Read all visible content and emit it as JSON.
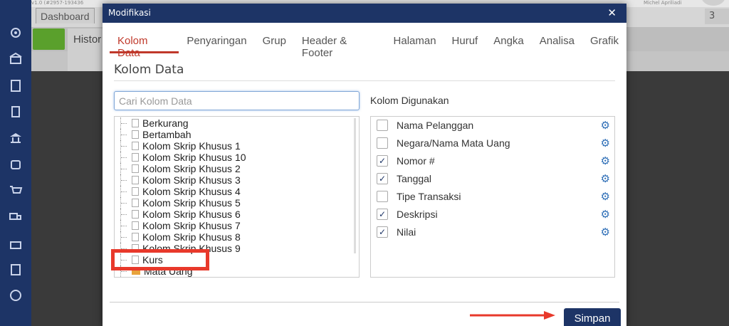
{
  "app": {
    "version": "v1.0 (#2957-193436",
    "user": "Michel Apriliadi",
    "tab_dashboard": "Dashboard",
    "tab_right_value": "3",
    "history_tab": "Histor"
  },
  "sidebar": {
    "icons": [
      "gear-icon",
      "store-icon",
      "building-icon",
      "book-icon",
      "bank-icon",
      "bag-icon",
      "cart-icon",
      "truck-icon",
      "inventory-icon",
      "tax-icon",
      "report-icon"
    ]
  },
  "dialog": {
    "title": "Modifikasi",
    "close": "✕",
    "tabs": [
      "Kolom Data",
      "Penyaringan",
      "Grup",
      "Header & Footer",
      "Halaman",
      "Huruf",
      "Angka",
      "Analisa",
      "Grafik"
    ],
    "active_tab": "Kolom Data",
    "section_title": "Kolom Data",
    "search_placeholder": "Cari Kolom Data",
    "tree_items": [
      {
        "label": "Berkurang",
        "type": "file"
      },
      {
        "label": "Bertambah",
        "type": "file"
      },
      {
        "label": "Kolom Skrip Khusus 1",
        "type": "file"
      },
      {
        "label": "Kolom Skrip Khusus 10",
        "type": "file"
      },
      {
        "label": "Kolom Skrip Khusus 2",
        "type": "file"
      },
      {
        "label": "Kolom Skrip Khusus 3",
        "type": "file"
      },
      {
        "label": "Kolom Skrip Khusus 4",
        "type": "file"
      },
      {
        "label": "Kolom Skrip Khusus 5",
        "type": "file"
      },
      {
        "label": "Kolom Skrip Khusus 6",
        "type": "file"
      },
      {
        "label": "Kolom Skrip Khusus 7",
        "type": "file"
      },
      {
        "label": "Kolom Skrip Khusus 8",
        "type": "file"
      },
      {
        "label": "Kolom Skrip Khusus 9",
        "type": "file"
      },
      {
        "label": "Kurs",
        "type": "file"
      },
      {
        "label": "Mata Uang",
        "type": "folder"
      }
    ],
    "used_title": "Kolom Digunakan",
    "used_columns": [
      {
        "label": "Nama Pelanggan",
        "checked": false
      },
      {
        "label": "Negara/Nama Mata Uang",
        "checked": false
      },
      {
        "label": "Nomor #",
        "checked": true
      },
      {
        "label": "Tanggal",
        "checked": true
      },
      {
        "label": "Tipe Transaksi",
        "checked": false
      },
      {
        "label": "Deskripsi",
        "checked": true
      },
      {
        "label": "Nilai",
        "checked": true
      }
    ],
    "save_label": "Simpan"
  },
  "colors": {
    "navy": "#1d3466",
    "accent_red": "#c0392b",
    "highlight_red": "#e8392b",
    "gear_blue": "#2f6fb7"
  }
}
